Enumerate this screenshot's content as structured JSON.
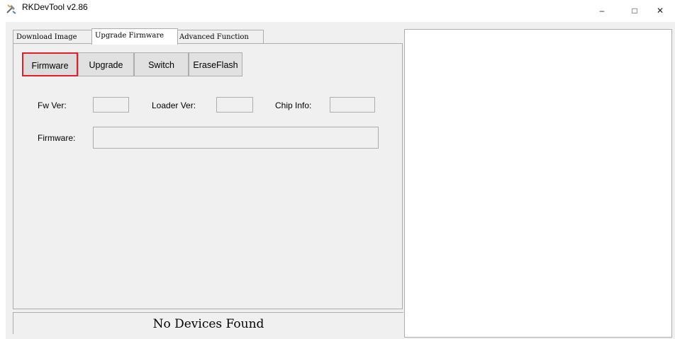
{
  "window": {
    "title": "RKDevTool v2.86",
    "controls": {
      "minimize": "–",
      "maximize": "□",
      "close": "✕"
    }
  },
  "tabs": [
    {
      "label": "Download Image",
      "selected": false
    },
    {
      "label": "Upgrade Firmware",
      "selected": true
    },
    {
      "label": "Advanced Function",
      "selected": false
    }
  ],
  "buttons": {
    "firmware": "Firmware",
    "upgrade": "Upgrade",
    "switch": "Switch",
    "erase_flash": "EraseFlash"
  },
  "fields": {
    "fw_ver_label": "Fw Ver:",
    "fw_ver_value": "",
    "loader_ver_label": "Loader Ver:",
    "loader_ver_value": "",
    "chip_info_label": "Chip Info:",
    "chip_info_value": "",
    "firmware_label": "Firmware:",
    "firmware_value": ""
  },
  "status": {
    "text": "No Devices Found"
  },
  "colors": {
    "highlight": "#e0202b",
    "panel_bg": "#f0f0f0",
    "log_bg": "#ffffff"
  },
  "icons": {
    "app": "rk-tool-icon"
  }
}
